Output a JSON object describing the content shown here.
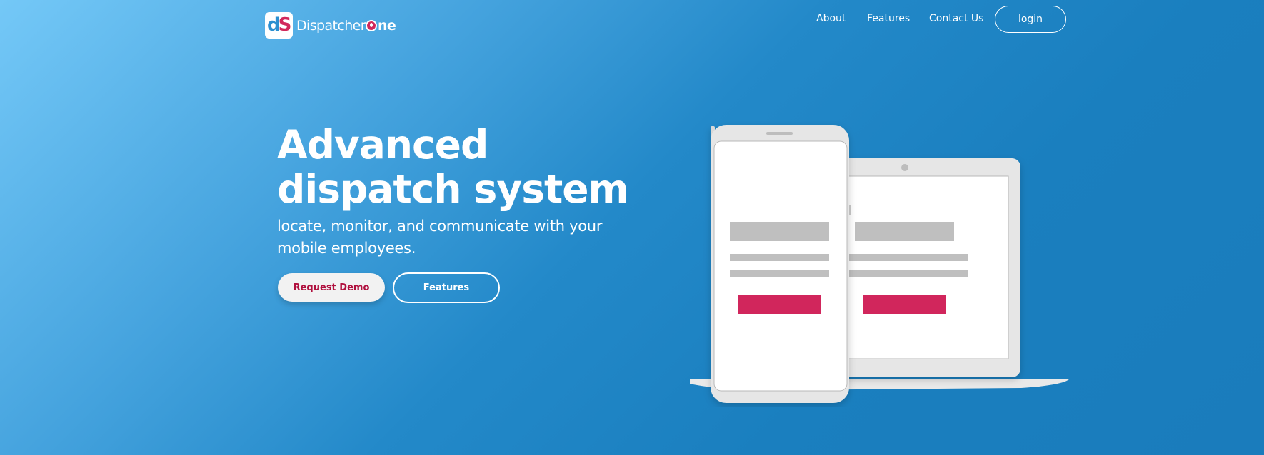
{
  "brand": {
    "name_prefix": "Dispatcher",
    "name_suffix": "ne",
    "badge_letters": [
      "d",
      "S"
    ]
  },
  "nav": {
    "items": [
      {
        "label": "About"
      },
      {
        "label": "Features"
      },
      {
        "label": "Contact Us"
      }
    ],
    "login_label": "login"
  },
  "hero": {
    "title_line1": "Advanced",
    "title_line2": "dispatch system",
    "subtitle": "locate, monitor, and communicate with your mobile employees.",
    "primary_button": "Request Demo",
    "secondary_button": "Features"
  },
  "icons": {
    "logo": "dispatcher-one-logo",
    "illustration": "phone-and-laptop-illustration"
  },
  "colors": {
    "gradient_start": "#74c8f7",
    "gradient_end": "#1a7cbc",
    "accent": "#d1285b",
    "demo_text": "#b0103e",
    "device_frame": "#e6e6e6",
    "placeholder_gray": "#bfbfbf"
  }
}
